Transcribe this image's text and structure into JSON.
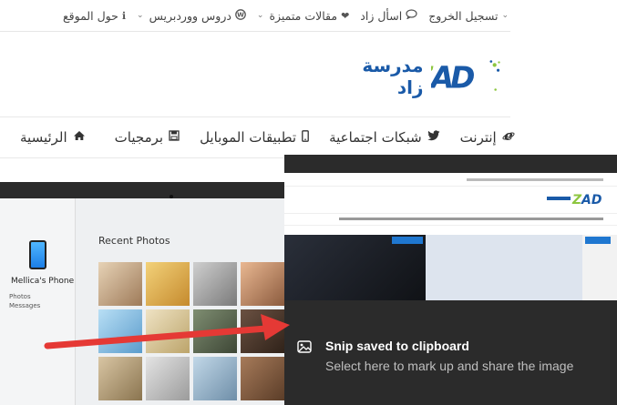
{
  "topnav": {
    "items": [
      {
        "label": "حول الموقع",
        "icon": "info-icon"
      },
      {
        "label": "دروس ووردبريس",
        "icon": "wordpress-icon",
        "has_caret": true
      },
      {
        "label": "مقالات متميزة",
        "icon": "heart-icon",
        "has_caret": true
      },
      {
        "label": "اسأل زاد",
        "icon": "comment-icon"
      },
      {
        "label": "تسجيل الخروج",
        "icon": "caret-icon"
      }
    ]
  },
  "logo": {
    "text": "مدرسة زاد"
  },
  "mainnav": {
    "items": [
      {
        "label": "الرئيسية",
        "icon": "home-icon"
      },
      {
        "label": "برمجيات",
        "icon": "save-icon"
      },
      {
        "label": "تطبيقات الموبايل",
        "icon": "mobile-icon"
      },
      {
        "label": "شبكات اجتماعية",
        "icon": "twitter-icon"
      },
      {
        "label": "إنترنت",
        "icon": "ie-icon"
      }
    ]
  },
  "photos": {
    "title": "Recent Photos",
    "phone_name": "Mellica's Phone",
    "side_rows": [
      "Photos",
      "Messages"
    ]
  },
  "toast": {
    "title": "Snip saved to clipboard",
    "body": "Select here to mark up and share the image",
    "icon": "image-icon"
  },
  "colors": {
    "brand_blue": "#1a5aa8",
    "logo_green": "#8dc63f",
    "toast_bg": "#2b2b2b",
    "arrow_red": "#e53935"
  }
}
